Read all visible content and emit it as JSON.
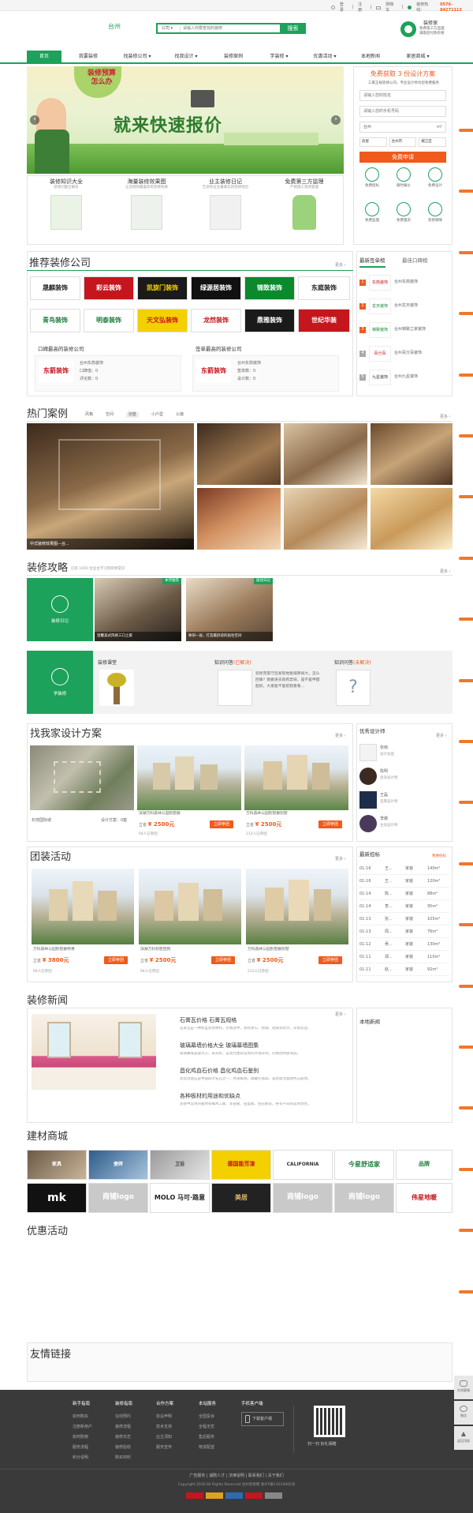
{
  "topbar": {
    "login": "登录",
    "register": "注册",
    "cart": "购物车",
    "hotline_label": "装修热线：",
    "hotline": "0576-84271113"
  },
  "header": {
    "city": "台州",
    "search_category": "公司",
    "search_placeholder": "请输入你要查找的装修",
    "search_button": "搜索",
    "guarantee_title": "装修保",
    "guarantee_sub1": "免费第三方监理",
    "guarantee_sub2": "满意后付款有保"
  },
  "nav": [
    "首页",
    "我要装修",
    "找装修公司 ▾",
    "找我设计 ▾",
    "装修案例",
    "学装修 ▾",
    "优惠活动 ▾",
    "本地新闻",
    "家居商城 ▾"
  ],
  "banner": {
    "headline": "就来快速报价",
    "badge": "装修预算怎么办",
    "prev": "‹",
    "next": "›"
  },
  "features": [
    {
      "title": "装修知识大全",
      "sub": "装修问题全解答"
    },
    {
      "title": "海量装修效果图",
      "sub": "让您挑到最喜欢的装修效果"
    },
    {
      "title": "业主装修日记",
      "sub": "告诉你业主最真实的装修经历"
    },
    {
      "title": "免费第三方监理",
      "sub": "严格施工现场管理"
    }
  ],
  "quote_form": {
    "title_pre": "免费获取 ",
    "title_num": "3",
    "title_post": " 份设计方案",
    "desc": "三家正规装修公司，专业设计师为您免费服务",
    "name_placeholder": "请输入您的姓名",
    "phone_placeholder": "请输入您的手机号码",
    "area_value": "台州",
    "area_unit": "m²",
    "selects": [
      "房屋",
      "台州市",
      "椒江区"
    ],
    "submit": "免费申请"
  },
  "quick_services": [
    "免费招标",
    "随时报价",
    "免费设计",
    "免费监理",
    "免费量房",
    "装修保障"
  ],
  "companies": {
    "title": "推荐装修公司",
    "more": "更多 ›",
    "logos": [
      "晟麒装饰",
      "彩云装饰",
      "凯旋门装饰",
      "绿源居装饰",
      "锦致装饰",
      "东庭装饰",
      "青鸟装饰",
      "明泰装饰",
      "天文弘装饰",
      "龙然装饰",
      "鼎雅装饰",
      "世纪华装"
    ],
    "good_title": "口碑最高的装修公司",
    "sign_title": "签单最高的装修公司",
    "cards": [
      {
        "name": "东箭装饰",
        "label": "台州东箭装饰",
        "stat1": "口碑值：0",
        "stat2": "评论数：0"
      },
      {
        "name": "东箭装饰",
        "label": "台州东箭装饰",
        "stat1": "签单数：0",
        "stat2": "设计数：0"
      }
    ]
  },
  "rankings": {
    "tab_active": "最新签单榜",
    "tab_other": "最佳口碑榜",
    "items": [
      {
        "num": "1",
        "name": "东箭装饰",
        "label": "台州东箭装饰"
      },
      {
        "num": "2",
        "name": "龙天装饰",
        "label": "台州龙天装饰"
      },
      {
        "num": "3",
        "name": "锦致装饰",
        "label": "台州锦致之家装饰"
      },
      {
        "num": "4",
        "name": "百分百",
        "label": "台州百分百装饰"
      },
      {
        "num": "5",
        "name": "九星装饰",
        "label": "台州九星装饰"
      }
    ]
  },
  "cases": {
    "title": "热门案例",
    "tabs": [
      "风格",
      "空间",
      "别墅",
      "小户型",
      "公装"
    ],
    "more": "更多 ›",
    "caption": "中式装修效果图—台..."
  },
  "guide": {
    "title": "装修攻略",
    "subtitle": "已有 1000 位业主学习到装修常识",
    "more": "更多 ›",
    "diary_label": "装修日记",
    "diary_items": [
      {
        "tag": "本月推荐",
        "caption": "温馨美式风格三口之家"
      },
      {
        "tag": "居住日记",
        "caption": "休闲一居，打造最舒适的居住空间"
      }
    ],
    "learn_label": "学装修",
    "class_title": "装修课堂",
    "qa_title1": "知识问答",
    "qa_solved": "(已解决)",
    "qa_text": "装修完客厅后发现地板缝隙很大，怎么回事？刚搬进去就有异味，是不是甲醛超标，大家能不能帮我看看...",
    "qa_title2": "知识问答",
    "qa_unsolved": "(未解决)"
  },
  "design": {
    "title": "找我家设计方案",
    "more": "更多 ›",
    "plans": [
      {
        "name": "石地国际城",
        "extra": "设计方案：0套"
      },
      {
        "name": "滨湖万科森林公园别墅群",
        "price": "¥ 2500元",
        "btn": "立即参团",
        "signed": "94人已参团"
      },
      {
        "name": "万科森林公园别墅群别墅",
        "price": "¥ 2500元",
        "btn": "立即参团",
        "signed": "212人已参团"
      }
    ],
    "price_label": "立省",
    "designers_title": "优秀设计师",
    "designers": [
      {
        "name": "张雨",
        "title": "设计总监"
      },
      {
        "name": "陈明",
        "title": "资深设计师"
      },
      {
        "name": "王磊",
        "title": "首席设计师"
      },
      {
        "name": "李娜",
        "title": "主任设计师"
      }
    ]
  },
  "group": {
    "title": "团装活动",
    "more": "更多 ›",
    "items": [
      {
        "name": "万科森林公园别墅群特惠",
        "price": "¥ 3800元",
        "btn": "立即参团",
        "signed": "94人已参团"
      },
      {
        "name": "滨湖万科别墅团购",
        "price": "¥ 2500元",
        "btn": "立即参团",
        "signed": "94人已参团"
      },
      {
        "name": "万科森林公园别墅群别墅",
        "price": "¥ 2500元",
        "btn": "立即参团",
        "signed": "212人已参团"
      }
    ],
    "tenders_title": "最新招标",
    "tenders_link": "我要招标",
    "tenders": [
      {
        "date": "01-16",
        "name": "王...",
        "type": "家装",
        "size": "140m²"
      },
      {
        "date": "01-16",
        "name": "王...",
        "type": "家装",
        "size": "120m²"
      },
      {
        "date": "01-14",
        "name": "陈...",
        "type": "家装",
        "size": "88m²"
      },
      {
        "date": "01-14",
        "name": "李...",
        "type": "家装",
        "size": "95m²"
      },
      {
        "date": "01-13",
        "name": "张...",
        "type": "家装",
        "size": "105m²"
      },
      {
        "date": "01-13",
        "name": "周...",
        "type": "家装",
        "size": "76m²"
      },
      {
        "date": "01-12",
        "name": "吴...",
        "type": "家装",
        "size": "130m²"
      },
      {
        "date": "01-11",
        "name": "郑...",
        "type": "家装",
        "size": "110m²"
      },
      {
        "date": "01-11",
        "name": "赵...",
        "type": "家装",
        "size": "92m²"
      }
    ]
  },
  "news": {
    "title": "装修新闻",
    "more": "更多 ›",
    "headline": "石膏瓦价格 石膏瓦规格",
    "headline_desc": "石膏瓦是一种新型装饰材料，价格适中，具有防火、防潮、轻质等优点，深受欢迎。",
    "items": [
      {
        "t": "玻璃幕墙价格大全 玻璃幕墙图集",
        "d": "玻璃幕墙美观大方，采光好，是现代建筑常用的外墙装饰，价格因材质而异。"
      },
      {
        "t": "昌化鸡血石价格 昌化鸡血石鉴别",
        "d": "昌化鸡血石是中国四大名石之一，色泽鲜艳，收藏价值高，鉴别需注意颜色与质地。"
      },
      {
        "t": "各种板材的用途和优缺点",
        "d": "装修中常用的板材有细木工板、多层板、密度板、刨花板等，各有不同的适用场合。"
      }
    ],
    "local_title": "本地新闻"
  },
  "mall": {
    "title": "建材商城",
    "logos": [
      "家具",
      "瓷砖",
      "卫浴",
      "德国能芳漆",
      "CALIFORNIA",
      "今星舒适家",
      "品牌"
    ],
    "logos2": [
      "mk",
      "商铺logo",
      "MOLO 马可·路意",
      "美居",
      "商铺logo",
      "伟星地暖"
    ]
  },
  "promo": {
    "title": "优惠活动"
  },
  "links": {
    "title": "友情链接"
  },
  "footer": {
    "cols": [
      {
        "h": "新手指南",
        "l": [
          "如何购买",
          "注册新用户",
          "如何购物",
          "服务流程",
          "积分说明"
        ]
      },
      {
        "h": "装修指南",
        "l": [
          "在线预约",
          "装修流程",
          "装修日志",
          "装修验收",
          "购买材料"
        ]
      },
      {
        "h": "合作方案",
        "l": [
          "协议声明",
          "技术支持",
          "业主须知",
          "服务宣传"
        ]
      },
      {
        "h": "本站服务",
        "l": [
          "全国投诉",
          "全程无忧",
          "售后服务",
          "物流配送"
        ]
      },
      {
        "h": "手机客户端",
        "l": [
          "下载客户端"
        ]
      }
    ],
    "qr_caption": "扫一扫 好礼相赠",
    "bottom_links": [
      "广告服务",
      "诚聘人才",
      "法律说明",
      "联系我们",
      "关于我们"
    ],
    "copyright": "Copyright 2016,All Rights Reserved 台州装修网 浙ICP备13010842号"
  },
  "float_sidebar": [
    "在线客服",
    "微信",
    "返回顶部"
  ],
  "colors": {
    "brand": "#1ca25a",
    "accent": "#f05a1c",
    "footer_bg": "#3a3a3a"
  }
}
